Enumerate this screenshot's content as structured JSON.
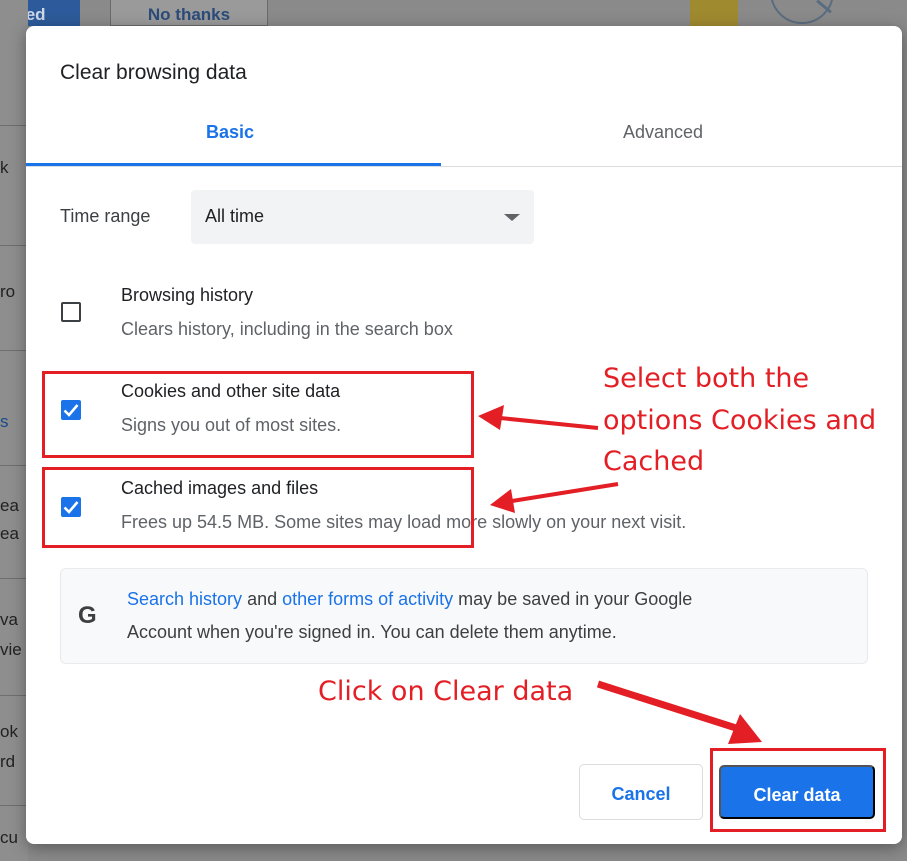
{
  "background": {
    "left_fragments": [
      "k",
      "ro",
      "s",
      "ea",
      "ea",
      "va",
      "vie",
      "ok",
      "rd",
      "cu"
    ],
    "top_blue_button": "arted",
    "top_white_button": "No thanks"
  },
  "dialog": {
    "title": "Clear browsing data",
    "tabs": [
      {
        "label": "Basic",
        "active": true
      },
      {
        "label": "Advanced",
        "active": false
      }
    ],
    "time_range": {
      "label": "Time range",
      "value": "All time"
    },
    "items": [
      {
        "title": "Browsing history",
        "description": "Clears history, including in the search box",
        "checked": false
      },
      {
        "title": "Cookies and other site data",
        "description": "Signs you out of most sites.",
        "checked": true
      },
      {
        "title": "Cached images and files",
        "description": "Frees up 54.5 MB. Some sites may load more slowly on your next visit.",
        "checked": true
      }
    ],
    "info": {
      "icon": "google-g-icon",
      "link1": "Search history",
      "text1": " and ",
      "link2": "other forms of activity",
      "text2": " may be saved in your Google",
      "line2": "Account when you're signed in. You can delete them anytime."
    },
    "buttons": {
      "cancel": "Cancel",
      "clear": "Clear data"
    }
  },
  "annotations": {
    "select_line1": "Select both the",
    "select_line2": "options Cookies and",
    "select_line3": "Cached",
    "click_text": "Click on Clear data"
  },
  "colors": {
    "accent": "#1a73e8",
    "annotation": "#e31e24",
    "text_primary": "#202124",
    "text_secondary": "#5f6368"
  }
}
